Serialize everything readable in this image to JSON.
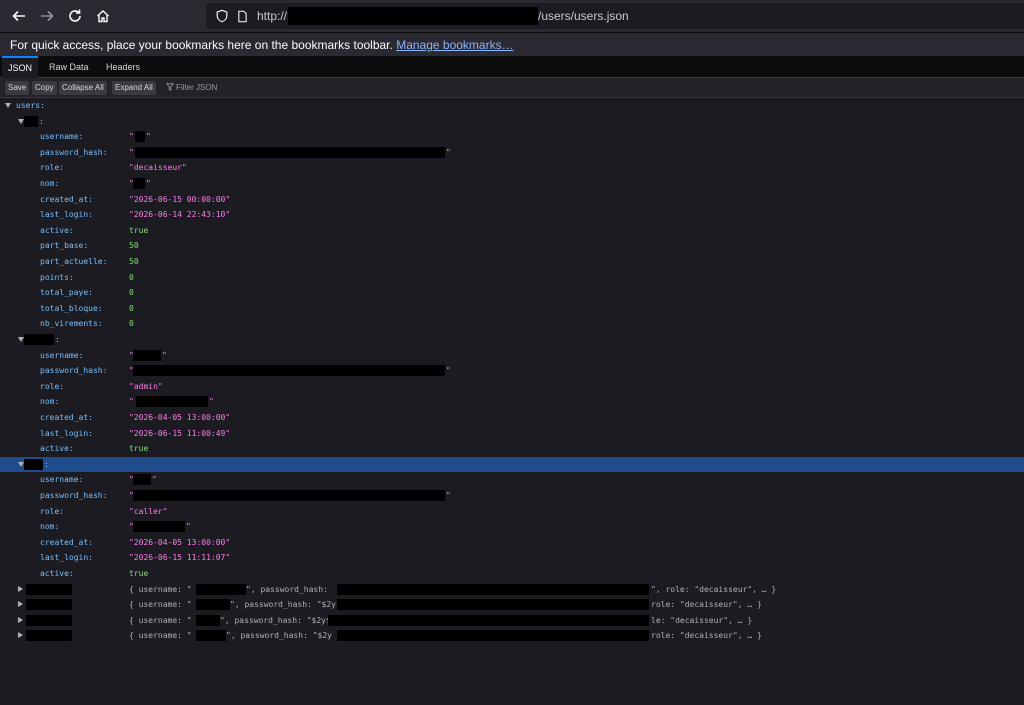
{
  "browser": {
    "url_prefix": "http://",
    "url_suffix": "/users/users.json",
    "bookmarks_text": "For quick access, place your bookmarks here on the bookmarks toolbar.",
    "bookmarks_link": "Manage bookmarks…"
  },
  "viewer": {
    "tabs": [
      "JSON",
      "Raw Data",
      "Headers"
    ],
    "buttons": [
      "Save",
      "Copy",
      "Collapse All",
      "Expand All"
    ],
    "filter_placeholder": "Filter JSON"
  },
  "tree": {
    "root_key": "users:",
    "user1": {
      "fields": [
        {
          "k": "username:",
          "v": "\"",
          "t": "str"
        },
        {
          "k": "password_hash:",
          "v": "\"",
          "t": "str"
        },
        {
          "k": "role:",
          "v": "\"decaisseur\"",
          "t": "str"
        },
        {
          "k": "nom:",
          "v": "\"",
          "t": "str"
        },
        {
          "k": "created_at:",
          "v": "\"2026-06-15 00:00:00\"",
          "t": "str"
        },
        {
          "k": "last_login:",
          "v": "\"2026-06-14 22:43:10\"",
          "t": "str"
        },
        {
          "k": "active:",
          "v": "true",
          "t": "bool"
        },
        {
          "k": "part_base:",
          "v": "50",
          "t": "num"
        },
        {
          "k": "part_actuelle:",
          "v": "50",
          "t": "num"
        },
        {
          "k": "points:",
          "v": "0",
          "t": "num"
        },
        {
          "k": "total_paye:",
          "v": "0",
          "t": "num"
        },
        {
          "k": "total_bloque:",
          "v": "0",
          "t": "num"
        },
        {
          "k": "nb_virements:",
          "v": "0",
          "t": "num"
        }
      ]
    },
    "user2": {
      "fields": [
        {
          "k": "username:",
          "v": "\"",
          "t": "str"
        },
        {
          "k": "password_hash:",
          "v": "\"",
          "t": "str"
        },
        {
          "k": "role:",
          "v": "\"admin\"",
          "t": "str"
        },
        {
          "k": "nom:",
          "v": "\"",
          "t": "str"
        },
        {
          "k": "created_at:",
          "v": "\"2026-04-05 13:00:00\"",
          "t": "str"
        },
        {
          "k": "last_login:",
          "v": "\"2026-06-15 11:00:49\"",
          "t": "str"
        },
        {
          "k": "active:",
          "v": "true",
          "t": "bool"
        }
      ]
    },
    "user3": {
      "fields": [
        {
          "k": "username:",
          "v": "\"",
          "t": "str"
        },
        {
          "k": "password_hash:",
          "v": "\"",
          "t": "str"
        },
        {
          "k": "role:",
          "v": "\"caller\"",
          "t": "str"
        },
        {
          "k": "nom:",
          "v": "\"",
          "t": "str"
        },
        {
          "k": "created_at:",
          "v": "\"2026-04-05 13:00:00\"",
          "t": "str"
        },
        {
          "k": "last_login:",
          "v": "\"2026-06-15 11:11:07\"",
          "t": "str"
        },
        {
          "k": "active:",
          "v": "true",
          "t": "bool"
        }
      ]
    },
    "collapsed": [
      {
        "pre": "{ username: \"",
        "mid": "\", password_hash: ",
        "post": "\", role: \"decaisseur\", … }"
      },
      {
        "pre": "{ username: \"",
        "mid": "\", password_hash: \"$2y",
        "post": "role: \"decaisseur\", … }"
      },
      {
        "pre": "{ username: \"",
        "mid": "\", password_hash: \"$2y$",
        "post": "le: \"decaisseur\", … }"
      },
      {
        "pre": "{ username: \"",
        "mid": "\", password_hash: \"$2y",
        "post": "role: \"decaisseur\", … }"
      }
    ]
  },
  "colors": {
    "key": "#75bfff",
    "string": "#ff7de9",
    "number": "#86de74",
    "selected_row": "#1f4d8c"
  },
  "icons": [
    "back-arrow-icon",
    "forward-arrow-icon",
    "reload-icon",
    "home-icon",
    "shield-icon",
    "page-icon",
    "filter-icon"
  ]
}
